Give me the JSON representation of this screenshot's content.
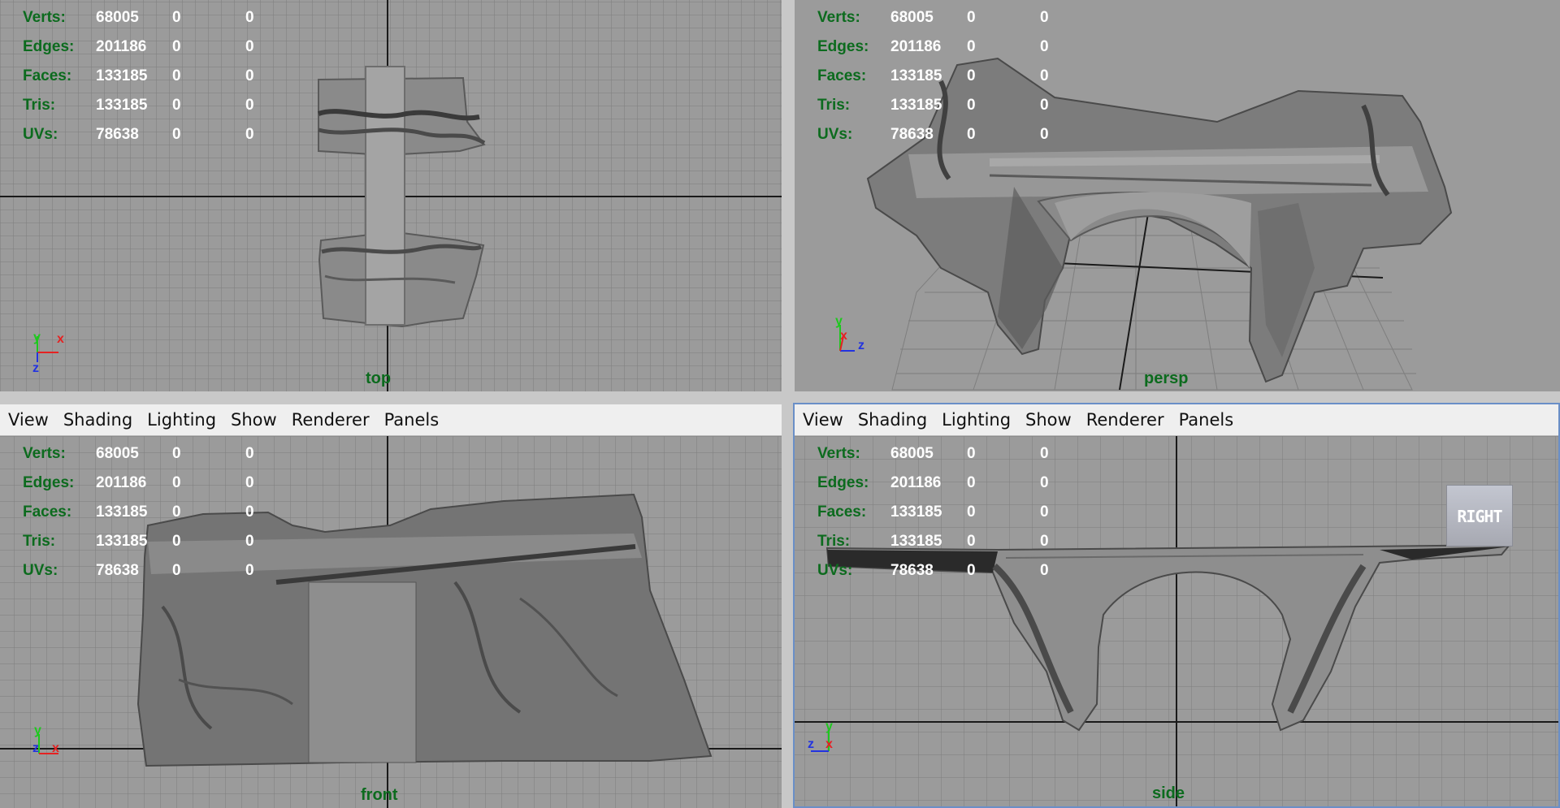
{
  "menu": [
    "View",
    "Shading",
    "Lighting",
    "Show",
    "Renderer",
    "Panels"
  ],
  "hud_stats": [
    {
      "label": "Verts:",
      "value": "68005",
      "sel": "0",
      "comp": "0"
    },
    {
      "label": "Edges:",
      "value": "201186",
      "sel": "0",
      "comp": "0"
    },
    {
      "label": "Faces:",
      "value": "133185",
      "sel": "0",
      "comp": "0"
    },
    {
      "label": "Tris:",
      "value": "133185",
      "sel": "0",
      "comp": "0"
    },
    {
      "label": "UVs:",
      "value": "78638",
      "sel": "0",
      "comp": "0"
    }
  ],
  "viewports": {
    "top": {
      "camera": "top",
      "axes": [
        "y",
        "x",
        "z"
      ]
    },
    "persp": {
      "camera": "persp",
      "axes": [
        "y",
        "x",
        "z"
      ]
    },
    "front": {
      "camera": "front",
      "axes": [
        "y",
        "z",
        "x"
      ]
    },
    "side": {
      "camera": "side",
      "axes": [
        "y",
        "z",
        "x"
      ],
      "view_cube": "RIGHT"
    }
  },
  "colors": {
    "hud_label": "#0c6b1e",
    "hud_value": "#ffffff",
    "viewport_bg": "#9b9b9b",
    "grid_line": "#7e7e7e",
    "axis_line": "#1a1a1a",
    "active_border": "#6a8fc7"
  }
}
